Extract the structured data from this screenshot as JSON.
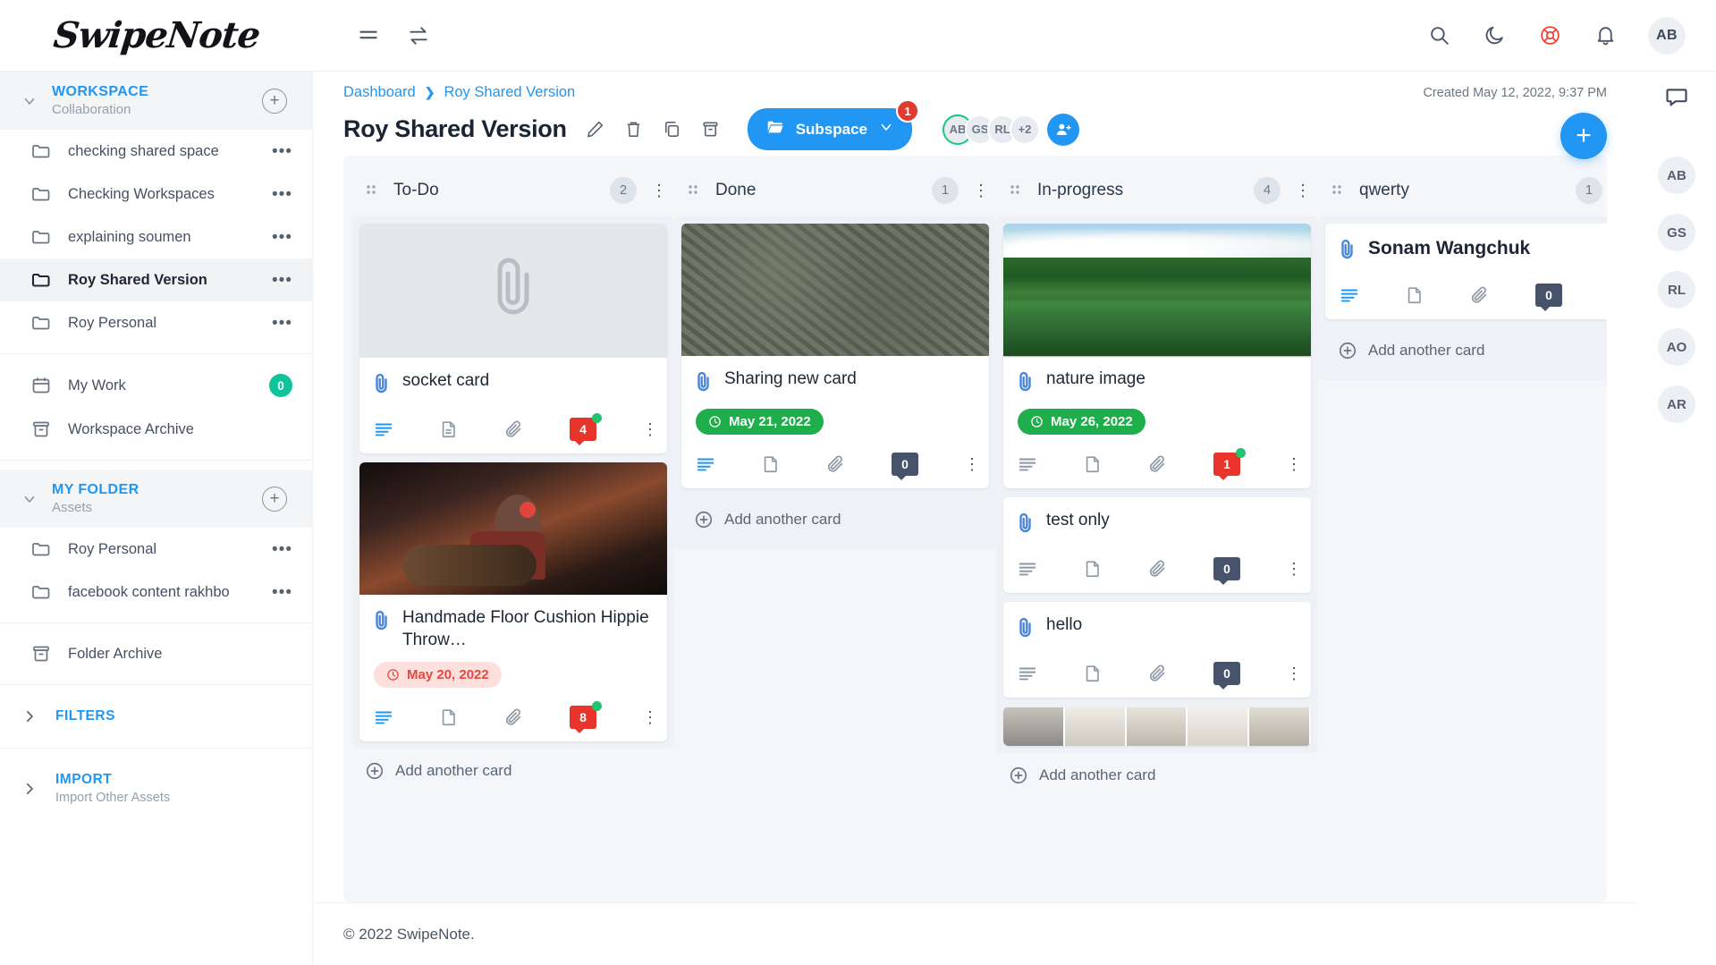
{
  "brand": {
    "name": "SwipeNote"
  },
  "topbar": {
    "menu_icon": "hamburger-icon",
    "switch_icon": "transfer-icon",
    "search_icon": "search-icon",
    "theme_icon": "moon-icon",
    "help_icon": "lifebuoy-icon",
    "bell_icon": "bell-icon",
    "avatar_initials": "AB"
  },
  "sidebar": {
    "workspace": {
      "title": "WORKSPACE",
      "subtitle": "Collaboration",
      "add_label": "+",
      "items": [
        {
          "label": "checking shared space",
          "icon": "folder-icon",
          "active": false
        },
        {
          "label": "Checking Workspaces",
          "icon": "folder-icon",
          "active": false
        },
        {
          "label": "explaining soumen",
          "icon": "folder-icon",
          "active": false
        },
        {
          "label": "Roy Shared Version",
          "icon": "folder-icon",
          "active": true
        },
        {
          "label": "Roy Personal",
          "icon": "folder-icon",
          "active": false
        }
      ]
    },
    "my_work": {
      "label": "My Work",
      "icon": "calendar-icon",
      "count": "0"
    },
    "workspace_archive": {
      "label": "Workspace Archive",
      "icon": "archive-icon"
    },
    "my_folder": {
      "title": "MY FOLDER",
      "subtitle": "Assets",
      "add_label": "+",
      "items": [
        {
          "label": "Roy Personal",
          "icon": "folder-icon"
        },
        {
          "label": "facebook content rakhbo",
          "icon": "folder-icon"
        }
      ]
    },
    "folder_archive": {
      "label": "Folder Archive",
      "icon": "archive-icon"
    },
    "filters": {
      "title": "FILTERS",
      "subtitle": ""
    },
    "import": {
      "title": "IMPORT",
      "subtitle": "Import Other Assets"
    }
  },
  "header": {
    "breadcrumb": [
      "Dashboard",
      "Roy Shared Version"
    ],
    "title": "Roy Shared Version",
    "created": "Created May 12, 2022, 9:37 PM",
    "actions": [
      "edit-icon",
      "trash-icon",
      "copy-icon",
      "archive-icon"
    ],
    "subspace": {
      "label": "Subspace",
      "badge": "1"
    },
    "members": [
      "AB",
      "GS",
      "RL"
    ],
    "members_overflow": "+2",
    "add_member_icon": "add-person-icon",
    "fab_label": "+"
  },
  "board": {
    "columns": [
      {
        "name": "To-Do",
        "count": "2",
        "add_label": "Add another card",
        "cards": [
          {
            "title": "socket card",
            "has_image": true,
            "image_kind": "paperclip-placeholder",
            "date": null,
            "comments": "4",
            "comment_color": "red",
            "comment_dot": true,
            "desc_active": true
          },
          {
            "title": "Handmade Floor Cushion Hippie Throw…",
            "has_image": true,
            "image_kind": "groot-photo",
            "date": "May 20, 2022",
            "date_style": "red",
            "comments": "8",
            "comment_color": "red",
            "comment_dot": true,
            "desc_active": true
          }
        ]
      },
      {
        "name": "Done",
        "count": "1",
        "add_label": "Add another card",
        "cards": [
          {
            "title": "Sharing new card",
            "has_image": true,
            "image_kind": "aerial-city-photo",
            "date": "May 21, 2022",
            "date_style": "green",
            "comments": "0",
            "comment_color": "grey",
            "comment_dot": false,
            "desc_active": true
          }
        ]
      },
      {
        "name": "In-progress",
        "count": "4",
        "add_label": "Add another card",
        "cards": [
          {
            "title": "nature image",
            "has_image": true,
            "image_kind": "lake-forest-photo",
            "date": "May 26, 2022",
            "date_style": "green",
            "comments": "1",
            "comment_color": "red",
            "comment_dot": true,
            "desc_active": false
          },
          {
            "title": "test only",
            "has_image": false,
            "date": null,
            "comments": "0",
            "comment_color": "grey",
            "comment_dot": false,
            "desc_active": false
          },
          {
            "title": "hello",
            "has_image": false,
            "date": null,
            "comments": "0",
            "comment_color": "grey",
            "comment_dot": false,
            "desc_active": false
          },
          {
            "title": "",
            "has_image": true,
            "image_kind": "interior-strip",
            "date": null,
            "comments": null
          }
        ]
      },
      {
        "name": "qwerty",
        "count": "1",
        "add_label": "Add another card",
        "cards": [
          {
            "title": "Sonam Wangchuk",
            "has_image": false,
            "date": null,
            "comments": "0",
            "comment_color": "grey",
            "comment_dot": false,
            "desc_active": true
          }
        ]
      }
    ]
  },
  "rail": {
    "chat_icon": "chat-icon",
    "avatars": [
      "AB",
      "GS",
      "RL",
      "AO",
      "AR"
    ]
  },
  "footer": {
    "text": "© 2022 SwipeNote."
  },
  "colors": {
    "accent": "#2196f3",
    "danger": "#e8342a",
    "success": "#1eae4b",
    "board_bg": "#f4f6f9",
    "column_bg": "#eef1f5",
    "teal": "#0fc39b"
  }
}
